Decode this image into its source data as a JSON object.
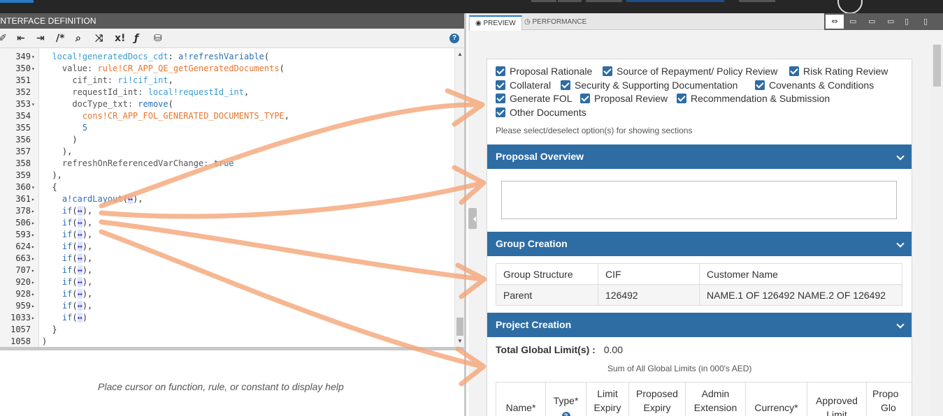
{
  "left_panel": {
    "header": "INTERFACE DEFINITION",
    "toolbar": [
      "/*",
      "x!"
    ],
    "help_text": "Place cursor on function, rule, or constant to display help"
  },
  "code_lines": [
    {
      "n": "349",
      "fold": "▾",
      "segs": [
        [
          "  ",
          ""
        ],
        [
          "local!generatedDocs_cdt",
          "var"
        ],
        [
          ": ",
          ""
        ],
        [
          "a!refreshVariable",
          "fn"
        ],
        [
          "(",
          ""
        ]
      ]
    },
    {
      "n": "350",
      "fold": "▾",
      "segs": [
        [
          "    value: ",
          "param"
        ],
        [
          "rule!CR_APP_QE_getGeneratedDocuments",
          "rule"
        ],
        [
          "(",
          ""
        ]
      ]
    },
    {
      "n": "351",
      "fold": "",
      "segs": [
        [
          "      cif_int: ",
          "param"
        ],
        [
          "ri!cif_int",
          "var"
        ],
        [
          ",",
          ""
        ]
      ]
    },
    {
      "n": "352",
      "fold": "",
      "segs": [
        [
          "      requestId_int: ",
          "param"
        ],
        [
          "local!requestId_int",
          "var"
        ],
        [
          ",",
          ""
        ]
      ]
    },
    {
      "n": "353",
      "fold": "▾",
      "segs": [
        [
          "      docType_txt: ",
          "param"
        ],
        [
          "remove",
          "fn"
        ],
        [
          "(",
          ""
        ]
      ]
    },
    {
      "n": "354",
      "fold": "",
      "segs": [
        [
          "        ",
          ""
        ],
        [
          "cons!CR_APP_FOL_GENERATED_DOCUMENTS_TYPE",
          "cons"
        ],
        [
          ",",
          ""
        ]
      ]
    },
    {
      "n": "355",
      "fold": "",
      "segs": [
        [
          "        ",
          ""
        ],
        [
          "5",
          "num"
        ]
      ]
    },
    {
      "n": "356",
      "fold": "",
      "segs": [
        [
          "      )",
          ""
        ]
      ]
    },
    {
      "n": "357",
      "fold": "",
      "segs": [
        [
          "    ),",
          ""
        ]
      ]
    },
    {
      "n": "358",
      "fold": "",
      "segs": [
        [
          "    refreshOnReferencedVarChange: ",
          "param"
        ],
        [
          "true",
          "bool"
        ]
      ]
    },
    {
      "n": "359",
      "fold": "",
      "segs": [
        [
          "  ),",
          ""
        ]
      ]
    },
    {
      "n": "360",
      "fold": "▾",
      "segs": [
        [
          "  {",
          ""
        ]
      ]
    },
    {
      "n": "361",
      "fold": "▸",
      "segs": [
        [
          "    ",
          ""
        ],
        [
          "a!cardLayout",
          "fn"
        ],
        [
          "(",
          ""
        ],
        [
          "↔",
          "arr"
        ],
        [
          "),",
          ""
        ]
      ]
    },
    {
      "n": "378",
      "fold": "▸",
      "segs": [
        [
          "    ",
          ""
        ],
        [
          "if",
          "fn"
        ],
        [
          "(",
          ""
        ],
        [
          "↔",
          "arr"
        ],
        [
          "),",
          ""
        ]
      ]
    },
    {
      "n": "506",
      "fold": "▸",
      "segs": [
        [
          "    ",
          ""
        ],
        [
          "if",
          "fn"
        ],
        [
          "(",
          ""
        ],
        [
          "↔",
          "arr"
        ],
        [
          "),",
          ""
        ]
      ]
    },
    {
      "n": "593",
      "fold": "▸",
      "segs": [
        [
          "    ",
          ""
        ],
        [
          "if",
          "fn"
        ],
        [
          "(",
          ""
        ],
        [
          "↔",
          "arr"
        ],
        [
          "),",
          ""
        ]
      ]
    },
    {
      "n": "624",
      "fold": "▸",
      "segs": [
        [
          "    ",
          ""
        ],
        [
          "if",
          "fn"
        ],
        [
          "(",
          ""
        ],
        [
          "↔",
          "arr"
        ],
        [
          "),",
          ""
        ]
      ]
    },
    {
      "n": "663",
      "fold": "▸",
      "segs": [
        [
          "    ",
          ""
        ],
        [
          "if",
          "fn"
        ],
        [
          "(",
          ""
        ],
        [
          "↔",
          "arr"
        ],
        [
          "),",
          ""
        ]
      ]
    },
    {
      "n": "707",
      "fold": "▸",
      "segs": [
        [
          "    ",
          ""
        ],
        [
          "if",
          "fn"
        ],
        [
          "(",
          ""
        ],
        [
          "↔",
          "arr"
        ],
        [
          "),",
          ""
        ]
      ]
    },
    {
      "n": "920",
      "fold": "▸",
      "segs": [
        [
          "    ",
          ""
        ],
        [
          "if",
          "fn"
        ],
        [
          "(",
          ""
        ],
        [
          "↔",
          "arr"
        ],
        [
          "),",
          ""
        ]
      ]
    },
    {
      "n": "928",
      "fold": "▸",
      "segs": [
        [
          "    ",
          ""
        ],
        [
          "if",
          "fn"
        ],
        [
          "(",
          ""
        ],
        [
          "↔",
          "arr"
        ],
        [
          "),",
          ""
        ]
      ]
    },
    {
      "n": "959",
      "fold": "▸",
      "segs": [
        [
          "    ",
          ""
        ],
        [
          "if",
          "fn"
        ],
        [
          "(",
          ""
        ],
        [
          "↔",
          "arr"
        ],
        [
          "),",
          ""
        ]
      ]
    },
    {
      "n": "1033",
      "fold": "▸",
      "segs": [
        [
          "    ",
          ""
        ],
        [
          "if",
          "fn"
        ],
        [
          "(",
          ""
        ],
        [
          "↔",
          "arr"
        ],
        [
          ")",
          ""
        ]
      ]
    },
    {
      "n": "1057",
      "fold": "",
      "segs": [
        [
          "  }",
          ""
        ]
      ]
    },
    {
      "n": "1058",
      "fold": "",
      "segs": [
        [
          ")",
          ""
        ]
      ]
    }
  ],
  "right_panel": {
    "tabs": [
      "PREVIEW",
      "PERFORMANCE"
    ],
    "checkboxes": [
      "Proposal Rationale",
      "Source of Repayment/ Policy Review",
      "Risk Rating Review",
      "Collateral",
      "Security & Supporting Documentation",
      "Covenants & Conditions",
      "Generate FOL",
      "Proposal Review",
      "Recommendation & Submission",
      "Other Documents"
    ],
    "checkbox_note": "Please select/deselect option(s) for showing sections",
    "sections": {
      "proposal_overview": "Proposal Overview",
      "group_creation": "Group Creation",
      "project_creation": "Project Creation"
    },
    "group_table": {
      "headers": [
        "Group Structure",
        "CIF",
        "Customer Name"
      ],
      "row": [
        "Parent",
        "126492",
        "NAME.1 OF 126492 NAME.2 OF 126492"
      ]
    },
    "total_global_limit_label": "Total Global Limit(s) :",
    "total_global_limit_value": "0.00",
    "sum_note": "Sum of All Global Limits (in 000's AED)",
    "project_columns": [
      {
        "l1": "",
        "l2": "Name*",
        "l3": ""
      },
      {
        "l1": "",
        "l2": "Type*",
        "l3": "?"
      },
      {
        "l1": "Limit",
        "l2": "Expiry",
        "l3": ""
      },
      {
        "l1": "Proposed",
        "l2": "Expiry",
        "l3": ""
      },
      {
        "l1": "Admin",
        "l2": "Extension",
        "l3": ""
      },
      {
        "l1": "",
        "l2": "Currency*",
        "l3": ""
      },
      {
        "l1": "",
        "l2": "Approved",
        "l3": "Limit"
      },
      {
        "l1": "Propo",
        "l2": "Glo",
        "l3": ""
      }
    ]
  },
  "colors": {
    "accent_blue": "#2e6da4",
    "dark_header": "#5a5a5a",
    "annotation_orange": "#f4a678"
  }
}
